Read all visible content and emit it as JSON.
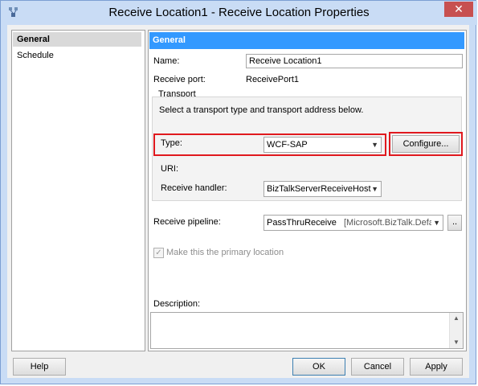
{
  "window": {
    "title": "Receive Location1 - Receive Location Properties",
    "close_glyph": "✕"
  },
  "nav": {
    "items": [
      {
        "label": "General",
        "selected": true
      },
      {
        "label": "Schedule",
        "selected": false
      }
    ]
  },
  "general": {
    "header": "General",
    "name_label": "Name:",
    "name_value": "Receive Location1",
    "port_label": "Receive port:",
    "port_value": "ReceivePort1",
    "transport": {
      "group_label": "Transport",
      "hint": "Select a transport type and transport address below.",
      "type_label": "Type:",
      "type_value": "WCF-SAP",
      "configure_label": "Configure...",
      "uri_label": "URI:",
      "handler_label": "Receive handler:",
      "handler_value": "BizTalkServerReceiveHost"
    },
    "pipeline_label": "Receive pipeline:",
    "pipeline_value": "PassThruReceive",
    "pipeline_assembly": "[Microsoft.BizTalk.Defau",
    "pipeline_browse": "..",
    "primary_label": "Make this the primary location",
    "primary_checked": true,
    "description_label": "Description:",
    "description_value": ""
  },
  "footer": {
    "help": "Help",
    "ok": "OK",
    "cancel": "Cancel",
    "apply": "Apply"
  },
  "colors": {
    "header_bg": "#3399ff",
    "highlight_border": "#e0191e",
    "close_bg": "#c75050"
  }
}
